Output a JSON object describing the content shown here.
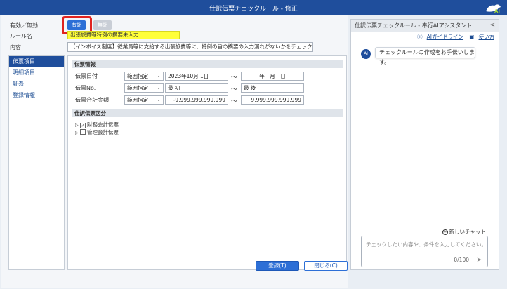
{
  "window": {
    "title": "仕訳伝票チェックルール - 修正"
  },
  "header": {
    "status_label": "有効／無効",
    "toggle_on": "有効",
    "toggle_off": "無効",
    "rule_name_label": "ルール名",
    "rule_name_value": "出張旅費等特例の摘要未入力",
    "content_label": "内容",
    "content_value": "【インボイス制度】従業員等に支給する出張旅費等に、特例の旨の摘要の入力漏れがないかをチェックします"
  },
  "sidebar": {
    "items": [
      {
        "label": "伝票項目",
        "active": true
      },
      {
        "label": "明細項目",
        "active": false
      },
      {
        "label": "証憑",
        "active": false
      },
      {
        "label": "登録情報",
        "active": false
      }
    ]
  },
  "form": {
    "section1_title": "伝票情報",
    "rows": [
      {
        "label": "伝票日付",
        "mode": "範囲指定",
        "from": "2023年10月 1日",
        "to": "年　月　日"
      },
      {
        "label": "伝票No.",
        "mode": "範囲指定",
        "from": "最 初",
        "to": "最 後"
      },
      {
        "label": "伝票合計金額",
        "mode": "範囲指定",
        "from": "-9,999,999,999,999",
        "to": "9,999,999,999,999"
      }
    ],
    "tilde": "～",
    "section2_title": "仕訳伝票区分",
    "tree": [
      {
        "label": "財務会計伝票",
        "checked": true
      },
      {
        "label": "管理会計伝票",
        "checked": false
      }
    ]
  },
  "buttons": {
    "register": "登録(T)",
    "close": "閉じる(C)"
  },
  "assistant": {
    "title": "仕訳伝票チェックルール - 奉行AIアシスタント",
    "collapse": "<",
    "guideline_link": "AIガイドライン",
    "usage_link": "使い方",
    "message": "チェックルールの作成をお手伝いします。",
    "new_chat": "新しいチャット",
    "input_placeholder": "チェックしたい内容や、条件を入力してください。",
    "counter": "0/100",
    "avatar_text": "AI",
    "logo_text": "AI"
  },
  "colors": {
    "titlebar": "#1f4e9c",
    "accent": "#2d6fd6",
    "highlight": "#ffff3a",
    "callout": "#e0231f"
  }
}
